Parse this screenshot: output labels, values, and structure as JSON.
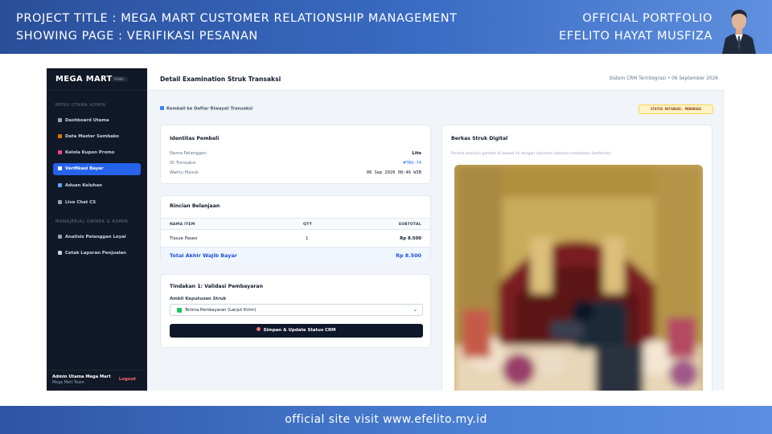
{
  "banner": {
    "project_title": "PROJECT TITLE  : MEGA MART CUSTOMER RELATIONSHIP MANAGEMENT",
    "showing_page": "SHOWING PAGE : VERIFIKASI PESANAN",
    "portfolio_label": "OFFICIAL PORTFOLIO",
    "author": "EFELITO HAYAT MUSFIZA"
  },
  "footer": {
    "text": "official site visit www.efelito.my.id"
  },
  "sidebar": {
    "brand": "MEGA MART",
    "brand_badge": "PANEL",
    "section_admin": "MENU UTAMA ADMIN",
    "section_owner": "MANAJERIAL OWNER & ADMIN",
    "items": [
      {
        "label": "Dashboard Utama",
        "icon": "chart-icon"
      },
      {
        "label": "Data Master Sembako",
        "icon": "box-icon"
      },
      {
        "label": "Kelola Kupon Promo",
        "icon": "ticket-icon"
      },
      {
        "label": "Verifikasi Bayar",
        "icon": "check-icon"
      },
      {
        "label": "Aduan Keluhan",
        "icon": "inbox-icon"
      },
      {
        "label": "Live Chat CS",
        "icon": "chat-icon"
      },
      {
        "label": "Analisis Pelanggan Loyal",
        "icon": "chart-icon"
      },
      {
        "label": "Cetak Laporan Penjualan",
        "icon": "printer-icon"
      }
    ],
    "user_name": "Admin Utama Mega Mart",
    "user_team": "Mega Mart Team",
    "logout": "Logout"
  },
  "topbar": {
    "title": "Detail Examination Struk Transaksi",
    "meta": "Sistem CRM Terintegrasi • 06 September 2026"
  },
  "back_link": "Kembali ke Daftar Riwayat Transaksi",
  "status_badge": "STATUS DATABASE: MENUNGGU",
  "buyer": {
    "title": "Identitas Pembeli",
    "name_label": "Nama Pelanggan",
    "name_value": "Lito",
    "id_label": "ID Transaksi",
    "id_value": "#TRX-74",
    "time_label": "Waktu Masuk",
    "time_value": "06 Sep 2026 08:46 WIB"
  },
  "order": {
    "title": "Rincian Belanjaan",
    "col_item": "NAMA ITEM",
    "col_qty": "QTY",
    "col_subtotal": "SUBTOTAL",
    "rows": [
      {
        "item": "Tissue Paseo",
        "qty": "1",
        "subtotal": "Rp 8.500"
      }
    ],
    "total_label": "Total Akhir Wajib Bayar",
    "total_value": "Rp 8.500"
  },
  "action": {
    "title": "Tindakan 1: Validasi Pembayaran",
    "decision_label": "Ambil Keputusan Struk",
    "decision_value": "Terima Pembayaran (Lanjut Kirim)",
    "submit": "Simpan & Update Status CRM"
  },
  "receipt": {
    "title": "Berkas Struk Digital",
    "hint": "Periksa keaslian gambar di bawah ini dengan saksama sebelum melakukan konfirmasi"
  },
  "colors": {
    "accent": "#2563eb",
    "sidebar_bg": "#111827",
    "status_bg": "#fef3c7",
    "button_bg": "#0f172a"
  }
}
